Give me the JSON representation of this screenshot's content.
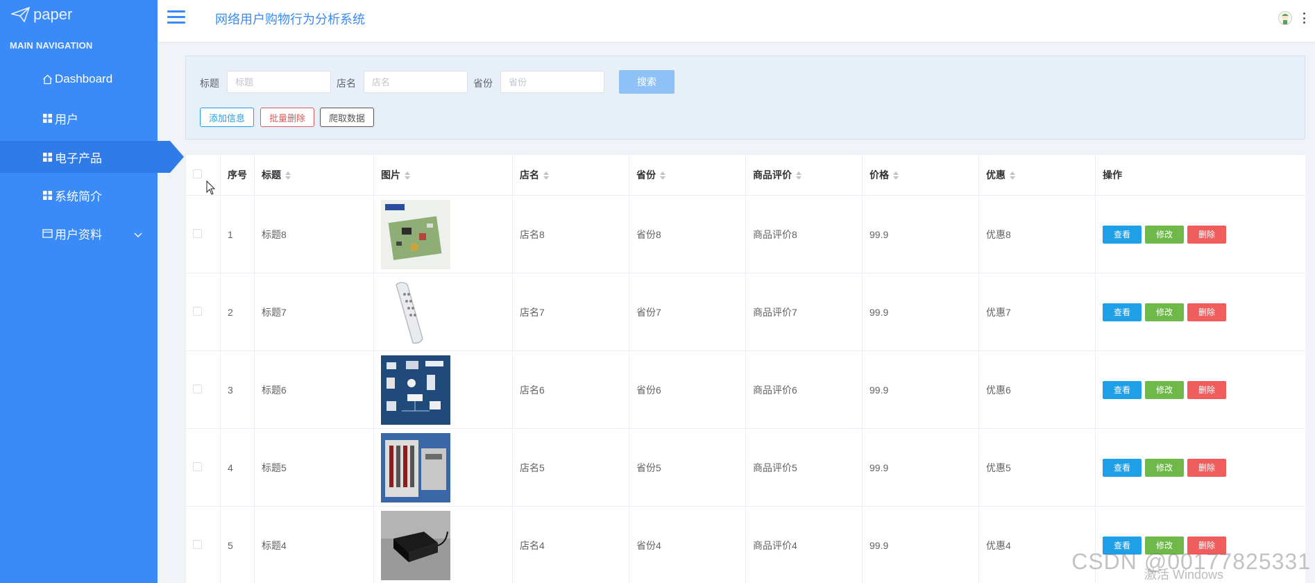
{
  "brand": {
    "name": "paper"
  },
  "sidebar": {
    "heading": "MAIN NAVIGATION",
    "items": [
      {
        "label": "Dashboard",
        "icon": "home-icon"
      },
      {
        "label": "用户",
        "icon": "grid-icon"
      },
      {
        "label": "电子产品",
        "icon": "grid-icon",
        "active": true
      },
      {
        "label": "系统简介",
        "icon": "grid-icon"
      },
      {
        "label": "用户资料",
        "icon": "card-icon",
        "expandable": true
      }
    ]
  },
  "header": {
    "title": "网络用户购物行为分析系统"
  },
  "search": {
    "title_label": "标题",
    "title_placeholder": "标题",
    "shop_label": "店名",
    "shop_placeholder": "店名",
    "province_label": "省份",
    "province_placeholder": "省份",
    "search_button": "搜索",
    "add_button": "添加信息",
    "batch_delete_button": "批量删除",
    "crawl_button": "爬取数据"
  },
  "table": {
    "columns": [
      "序号",
      "标题",
      "图片",
      "店名",
      "省份",
      "商品评价",
      "价格",
      "优惠",
      "操作"
    ],
    "rows": [
      {
        "index": "1",
        "title": "标题8",
        "shop": "店名8",
        "province": "省份8",
        "review": "商品评价8",
        "price": "99.9",
        "discount": "优惠8",
        "image": "circuit-board"
      },
      {
        "index": "2",
        "title": "标题7",
        "shop": "店名7",
        "province": "省份7",
        "review": "商品评价7",
        "price": "99.9",
        "discount": "优惠7",
        "image": "remote-control"
      },
      {
        "index": "3",
        "title": "标题6",
        "shop": "店名6",
        "province": "省份6",
        "review": "商品评价6",
        "price": "99.9",
        "discount": "优惠6",
        "image": "smart-home"
      },
      {
        "index": "4",
        "title": "标题5",
        "shop": "店名5",
        "province": "省份5",
        "review": "商品评价5",
        "price": "99.9",
        "discount": "优惠5",
        "image": "server-rack"
      },
      {
        "index": "5",
        "title": "标题4",
        "shop": "店名4",
        "province": "省份4",
        "review": "商品评价4",
        "price": "99.9",
        "discount": "优惠4",
        "image": "black-box"
      }
    ],
    "actions": {
      "view": "查看",
      "edit": "修改",
      "delete": "删除"
    }
  },
  "overlay": {
    "watermark": "CSDN @00177825331",
    "activation": "激活 Windows"
  },
  "colors": {
    "sidebar": "#3a8af7",
    "accent": "#3a8af7",
    "view": "#1e9fe8",
    "edit": "#6fb94a",
    "delete": "#ef5d5d"
  }
}
